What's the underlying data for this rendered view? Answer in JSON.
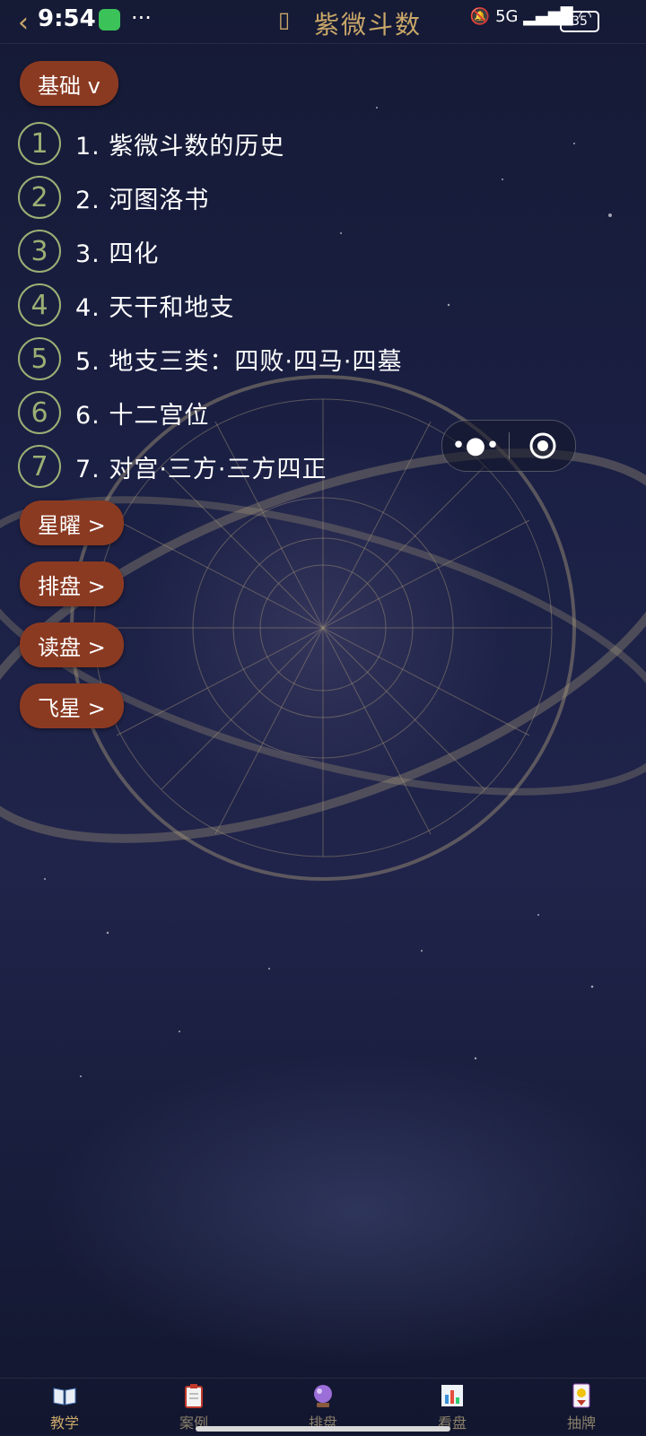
{
  "status_bar": {
    "time": "9:54",
    "network": "5G",
    "battery": "35",
    "title": "紫微斗数"
  },
  "sections": [
    {
      "label": "基础 v",
      "expanded": true
    },
    {
      "label": "星曜 >"
    },
    {
      "label": "排盘 >"
    },
    {
      "label": "读盘 >"
    },
    {
      "label": "飞星 >"
    }
  ],
  "lessons": [
    {
      "num": "1",
      "text": "1. 紫微斗数的历史"
    },
    {
      "num": "2",
      "text": "2. 河图洛书"
    },
    {
      "num": "3",
      "text": "3. 四化"
    },
    {
      "num": "4",
      "text": "4. 天干和地支"
    },
    {
      "num": "5",
      "text": "5. 地支三类：四败·四马·四墓"
    },
    {
      "num": "6",
      "text": "6. 十二宫位"
    },
    {
      "num": "7",
      "text": "7. 对宫·三方·三方四正"
    }
  ],
  "capsule": {
    "more_icon": "more-dots-icon",
    "close_icon": "target-circle-icon"
  },
  "tabs": [
    {
      "label": "教学",
      "icon": "book-icon",
      "active": true
    },
    {
      "label": "案例",
      "icon": "clipboard-icon"
    },
    {
      "label": "排盘",
      "icon": "crystal-ball-icon"
    },
    {
      "label": "看盘",
      "icon": "bar-chart-icon"
    },
    {
      "label": "抽牌",
      "icon": "card-icon"
    }
  ]
}
